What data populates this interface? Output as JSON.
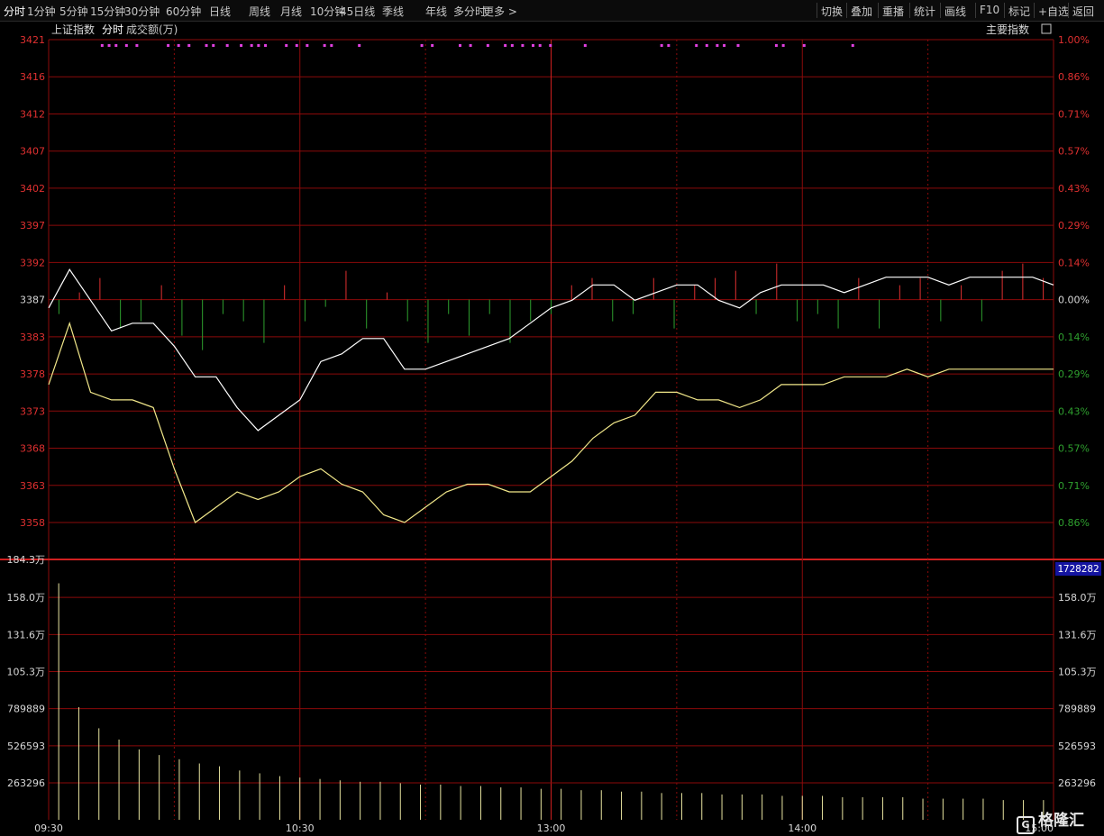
{
  "toolbar": {
    "left_items": [
      "分时",
      "1分钟",
      "5分钟",
      "15分钟",
      "30分钟",
      "60分钟",
      "日线",
      "周线",
      "月线",
      "10分钟",
      "45日线",
      "季线",
      "年线",
      "多分时",
      "更多 >"
    ],
    "active_index": 0,
    "right_items": [
      "切换",
      "叠加",
      "重播",
      "统计",
      "画线",
      "F10",
      "标记",
      "+自选",
      "返回"
    ]
  },
  "chart_header": {
    "index_name": "上证指数",
    "mode_label": "分时",
    "volume_label": "成交额(万)",
    "main_index_label": "主要指数"
  },
  "volume_badge": "1728282",
  "watermark": "格隆汇",
  "colors": {
    "grid": "#8b0a0a",
    "price_line": "#ffffff",
    "avg_line": "#f2e88a",
    "up_bar": "#e03030",
    "down_bar": "#2ea02e",
    "volume_bar": "#e8e4a0",
    "signal_marker": "#e040e0",
    "left_axis_text": "#e03030",
    "right_pct_up": "#e03030",
    "right_pct_down": "#2ea02e"
  },
  "chart_data": [
    {
      "type": "line",
      "price_ticks": [
        3421,
        3416,
        3412,
        3407,
        3402,
        3397,
        3392,
        3387,
        3383,
        3378,
        3373,
        3368,
        3363,
        3358
      ],
      "pct_ticks": [
        "1.00%",
        "0.86%",
        "0.71%",
        "0.57%",
        "0.43%",
        "0.29%",
        "0.14%",
        "0.00%",
        "0.14%",
        "0.29%",
        "0.43%",
        "0.57%",
        "0.71%",
        "0.86%"
      ],
      "ylim": [
        3354,
        3421
      ],
      "base_price": 3387,
      "time_labels": [
        "09:30",
        "10:30",
        "13:00",
        "14:00",
        "15:00"
      ],
      "x_total_minutes": 240,
      "series": [
        {
          "role": "price_line",
          "x": [
            0,
            5,
            10,
            15,
            20,
            25,
            30,
            35,
            40,
            45,
            50,
            55,
            60,
            65,
            70,
            75,
            80,
            85,
            90,
            95,
            100,
            105,
            110,
            115,
            120,
            125,
            130,
            135,
            140,
            145,
            150,
            155,
            160,
            165,
            170,
            175,
            180,
            185,
            190,
            195,
            200,
            205,
            210,
            215,
            220,
            225,
            230,
            235,
            240
          ],
          "values": [
            3386,
            3391,
            3387,
            3383,
            3384,
            3384,
            3381,
            3377,
            3377,
            3373,
            3370,
            3372,
            3374,
            3379,
            3380,
            3382,
            3382,
            3378,
            3378,
            3379,
            3380,
            3381,
            3382,
            3384,
            3386,
            3387,
            3389,
            3389,
            3387,
            3388,
            3389,
            3389,
            3387,
            3386,
            3388,
            3389,
            3389,
            3389,
            3388,
            3389,
            3390,
            3390,
            3390,
            3389,
            3390,
            3390,
            3390,
            3390,
            3389
          ]
        },
        {
          "role": "avg_line",
          "x": [
            0,
            5,
            10,
            15,
            20,
            25,
            30,
            35,
            40,
            45,
            50,
            55,
            60,
            65,
            70,
            75,
            80,
            85,
            90,
            95,
            100,
            105,
            110,
            115,
            120,
            125,
            130,
            135,
            140,
            145,
            150,
            155,
            160,
            165,
            170,
            175,
            180,
            185,
            190,
            195,
            200,
            205,
            210,
            215,
            220,
            225,
            230,
            235,
            240
          ],
          "values": [
            3376,
            3384,
            3375,
            3374,
            3374,
            3373,
            3365,
            3358,
            3360,
            3362,
            3361,
            3362,
            3364,
            3365,
            3363,
            3362,
            3359,
            3358,
            3360,
            3362,
            3363,
            3363,
            3362,
            3362,
            3364,
            3366,
            3369,
            3371,
            3372,
            3375,
            3375,
            3374,
            3374,
            3373,
            3374,
            3376,
            3376,
            3376,
            3377,
            3377,
            3377,
            3378,
            3377,
            3378,
            3378,
            3378,
            3378,
            3378,
            3378
          ]
        }
      ],
      "breadth_bars": [
        -2,
        1,
        3,
        -4,
        -3,
        2,
        -5,
        -7,
        -2,
        -3,
        -6,
        2,
        -3,
        -1,
        4,
        -4,
        1,
        -3,
        -6,
        -2,
        -5,
        -2,
        -6,
        -3,
        -2,
        2,
        3,
        -3,
        -2,
        3,
        -4,
        2,
        3,
        4,
        -2,
        5,
        -3,
        -2,
        -4,
        3,
        -4,
        2,
        3,
        -3,
        2,
        -3,
        4,
        5,
        3
      ]
    },
    {
      "type": "bar",
      "title": "",
      "ylabel": "成交额(万)",
      "y_ticks": [
        "184.3万",
        "158.0万",
        "131.6万",
        "105.3万",
        "789889",
        "526593",
        "263296"
      ],
      "ylim": [
        0,
        1843000
      ],
      "x_total_minutes": 240,
      "values": [
        1680000,
        800000,
        650000,
        570000,
        500000,
        460000,
        430000,
        400000,
        380000,
        350000,
        330000,
        310000,
        300000,
        290000,
        280000,
        270000,
        270000,
        260000,
        250000,
        250000,
        240000,
        240000,
        230000,
        230000,
        220000,
        220000,
        210000,
        210000,
        200000,
        200000,
        190000,
        190000,
        190000,
        180000,
        180000,
        180000,
        170000,
        170000,
        170000,
        160000,
        160000,
        160000,
        160000,
        150000,
        150000,
        150000,
        150000,
        140000,
        140000,
        140000
      ]
    }
  ]
}
